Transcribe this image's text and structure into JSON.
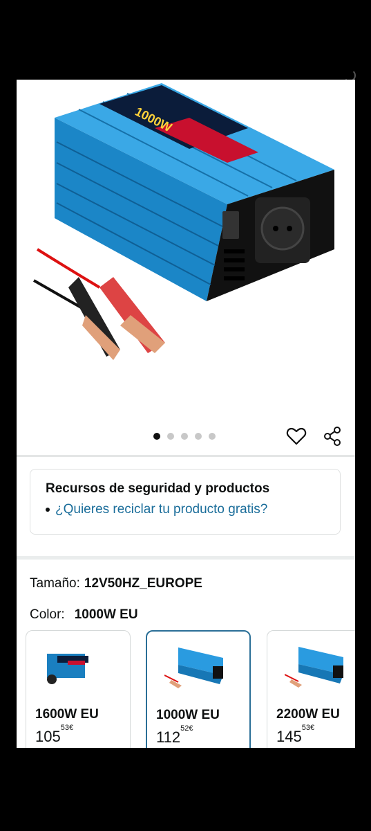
{
  "gallery": {
    "image_alt": "Inversor de corriente azul 1000W con pinzas de batería",
    "product_label": "1000W",
    "dots_total": 5,
    "dot_active": 1
  },
  "safety": {
    "title": "Recursos de seguridad y productos",
    "link": "¿Quieres reciclar tu producto gratis?"
  },
  "size": {
    "label": "Tamaño:",
    "value": "12V50HZ_EUROPE"
  },
  "color": {
    "label": "Color:",
    "value": "1000W EU"
  },
  "variants": [
    {
      "name": "1600W EU",
      "price_whole": "105",
      "price_frac": "53",
      "currency": "€"
    },
    {
      "name": "1000W EU",
      "price_whole": "112",
      "price_frac": "52",
      "currency": "€"
    },
    {
      "name": "2200W EU",
      "price_whole": "145",
      "price_frac": "53",
      "currency": "€"
    }
  ],
  "colors": {
    "accent": "#2a6f97",
    "link": "#1a6d9a",
    "inverter": "#1e90d6"
  }
}
